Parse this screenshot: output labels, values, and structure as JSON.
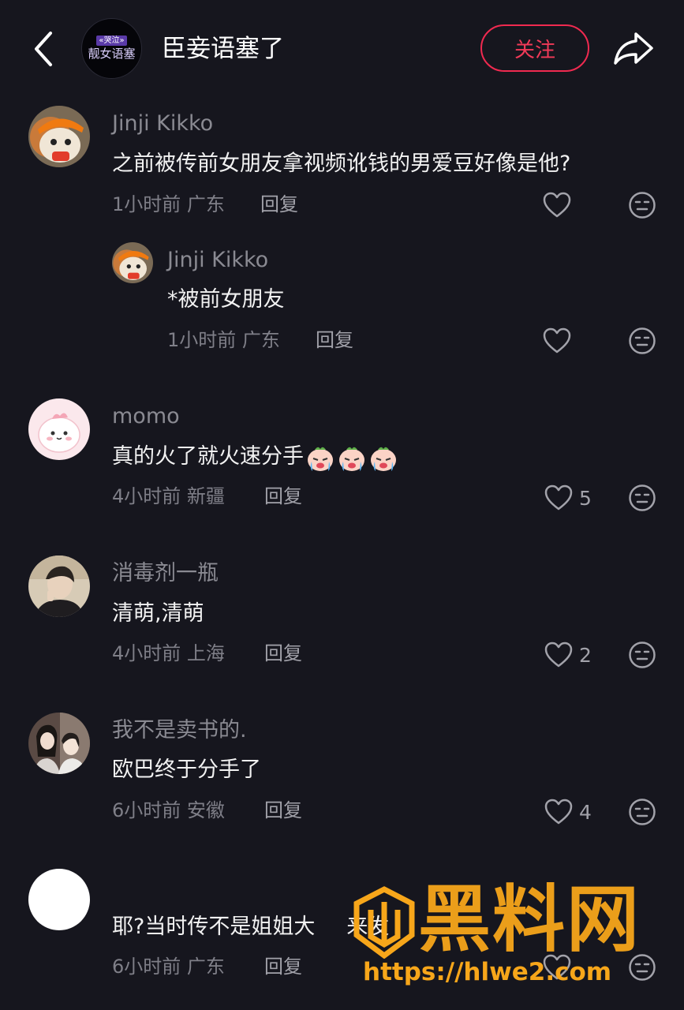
{
  "header": {
    "channel_avatar_badge": "«哭泣»",
    "channel_avatar_text": "靓女语塞",
    "title": "臣妾语塞了",
    "follow_label": "关注"
  },
  "comments": [
    {
      "username": "Jinji Kikko",
      "text": "之前被传前女朋友拿视频讹钱的男爱豆好像是他?",
      "time": "1小时前",
      "location": "广东",
      "reply_label": "回复",
      "likes": "",
      "replies": [
        {
          "username": "Jinji Kikko",
          "text": "*被前女朋友",
          "time": "1小时前",
          "location": "广东",
          "reply_label": "回复",
          "likes": ""
        }
      ]
    },
    {
      "username": "momo",
      "text": "真的火了就火速分手",
      "emoji": "crying-face",
      "time": "4小时前",
      "location": "新疆",
      "reply_label": "回复",
      "likes": "5"
    },
    {
      "username": "消毒剂一瓶",
      "text": "清萌,清萌",
      "time": "4小时前",
      "location": "上海",
      "reply_label": "回复",
      "likes": "2"
    },
    {
      "username": "我不是卖书的.",
      "text": "欧巴终于分手了",
      "time": "6小时前",
      "location": "安徽",
      "reply_label": "回复",
      "likes": "4"
    },
    {
      "username": "",
      "text": "耶?当时传不是姐姐大",
      "text_tail": "来发",
      "time": "6小时前",
      "location": "广东",
      "reply_label": "回复",
      "likes": ""
    }
  ],
  "watermark": {
    "title": "黑料网",
    "url": "https://hlwe2.com"
  },
  "colors": {
    "background": "#16161e",
    "accent": "#f02a50",
    "watermark": "#f7a61a"
  }
}
